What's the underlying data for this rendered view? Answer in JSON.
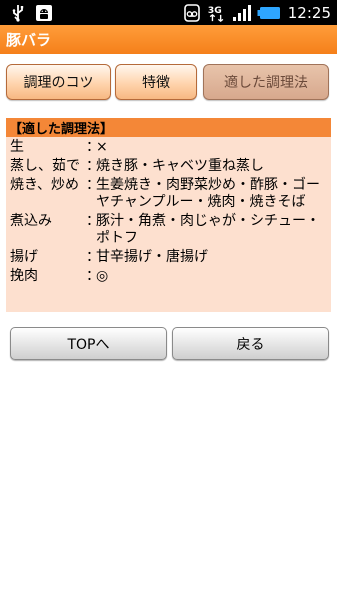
{
  "status_bar": {
    "time": "12:25",
    "network": "3G",
    "icons": [
      "usb-icon",
      "android-debug-icon",
      "voicemail-icon",
      "3g-icon",
      "signal-icon",
      "battery-icon"
    ]
  },
  "title": "豚バラ",
  "tabs": [
    {
      "label": "調理のコツ",
      "active": false
    },
    {
      "label": "特徴",
      "active": false
    },
    {
      "label": "適した調理法",
      "active": true
    }
  ],
  "panel": {
    "header": "【適した調理法】",
    "rows": [
      {
        "label": "生",
        "separator": "：",
        "value": "×"
      },
      {
        "label": "蒸し、茹で",
        "separator": "：",
        "value": "焼き豚・キャベツ重ね蒸し"
      },
      {
        "label": "焼き、炒め",
        "separator": "：",
        "value": "生姜焼き・肉野菜炒め・酢豚・ゴーヤチャンプルー・焼肉・焼きそば"
      },
      {
        "label": "煮込み",
        "separator": "：",
        "value": "豚汁・角煮・肉じゃが・シチュー・ポトフ"
      },
      {
        "label": "揚げ",
        "separator": "：",
        "value": "甘辛揚げ・唐揚げ"
      },
      {
        "label": "挽肉",
        "separator": "：",
        "value": "◎"
      }
    ]
  },
  "buttons": {
    "top": "TOPへ",
    "back": "戻る"
  },
  "colors": {
    "title_bar": "#f5801a",
    "panel_header": "#f48737",
    "panel_bg": "#fde0cf"
  }
}
